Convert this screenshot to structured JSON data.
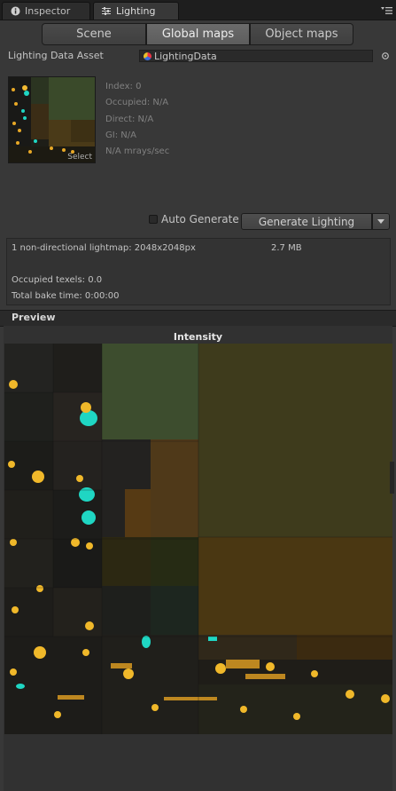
{
  "tabs": [
    {
      "label": "Inspector",
      "icon": "info-icon"
    },
    {
      "label": "Lighting",
      "icon": "sliders-icon"
    }
  ],
  "segments": [
    {
      "label": "Scene",
      "selected": false
    },
    {
      "label": "Global maps",
      "selected": true
    },
    {
      "label": "Object maps",
      "selected": false
    }
  ],
  "lighting_data": {
    "label": "Lighting Data Asset",
    "value": "LightingData",
    "icon": "lighting-data-asset-icon"
  },
  "thumbnail": {
    "select_label": "Select"
  },
  "map_info": {
    "index": "Index: 0",
    "occupied": "Occupied: N/A",
    "direct": "Direct: N/A",
    "gi": "GI: N/A",
    "rate": "N/A mrays/sec"
  },
  "generate": {
    "auto_label": "Auto Generate",
    "auto_checked": false,
    "button_label": "Generate Lighting"
  },
  "summary": {
    "lightmaps": "1 non-directional lightmap: 2048x2048px",
    "size": "2.7 MB",
    "texels": "Occupied texels: 0.0",
    "bake_time": "Total bake time: 0:00:00"
  },
  "preview": {
    "header": "Preview",
    "title": "Intensity"
  },
  "colors": {
    "panel_bg": "#383838",
    "tab_bar_bg": "#1e1e1e",
    "selected_segment": "#5d5d5d",
    "cyan_highlight": "#1fd6c3",
    "warm_light": "#f0b82a"
  }
}
